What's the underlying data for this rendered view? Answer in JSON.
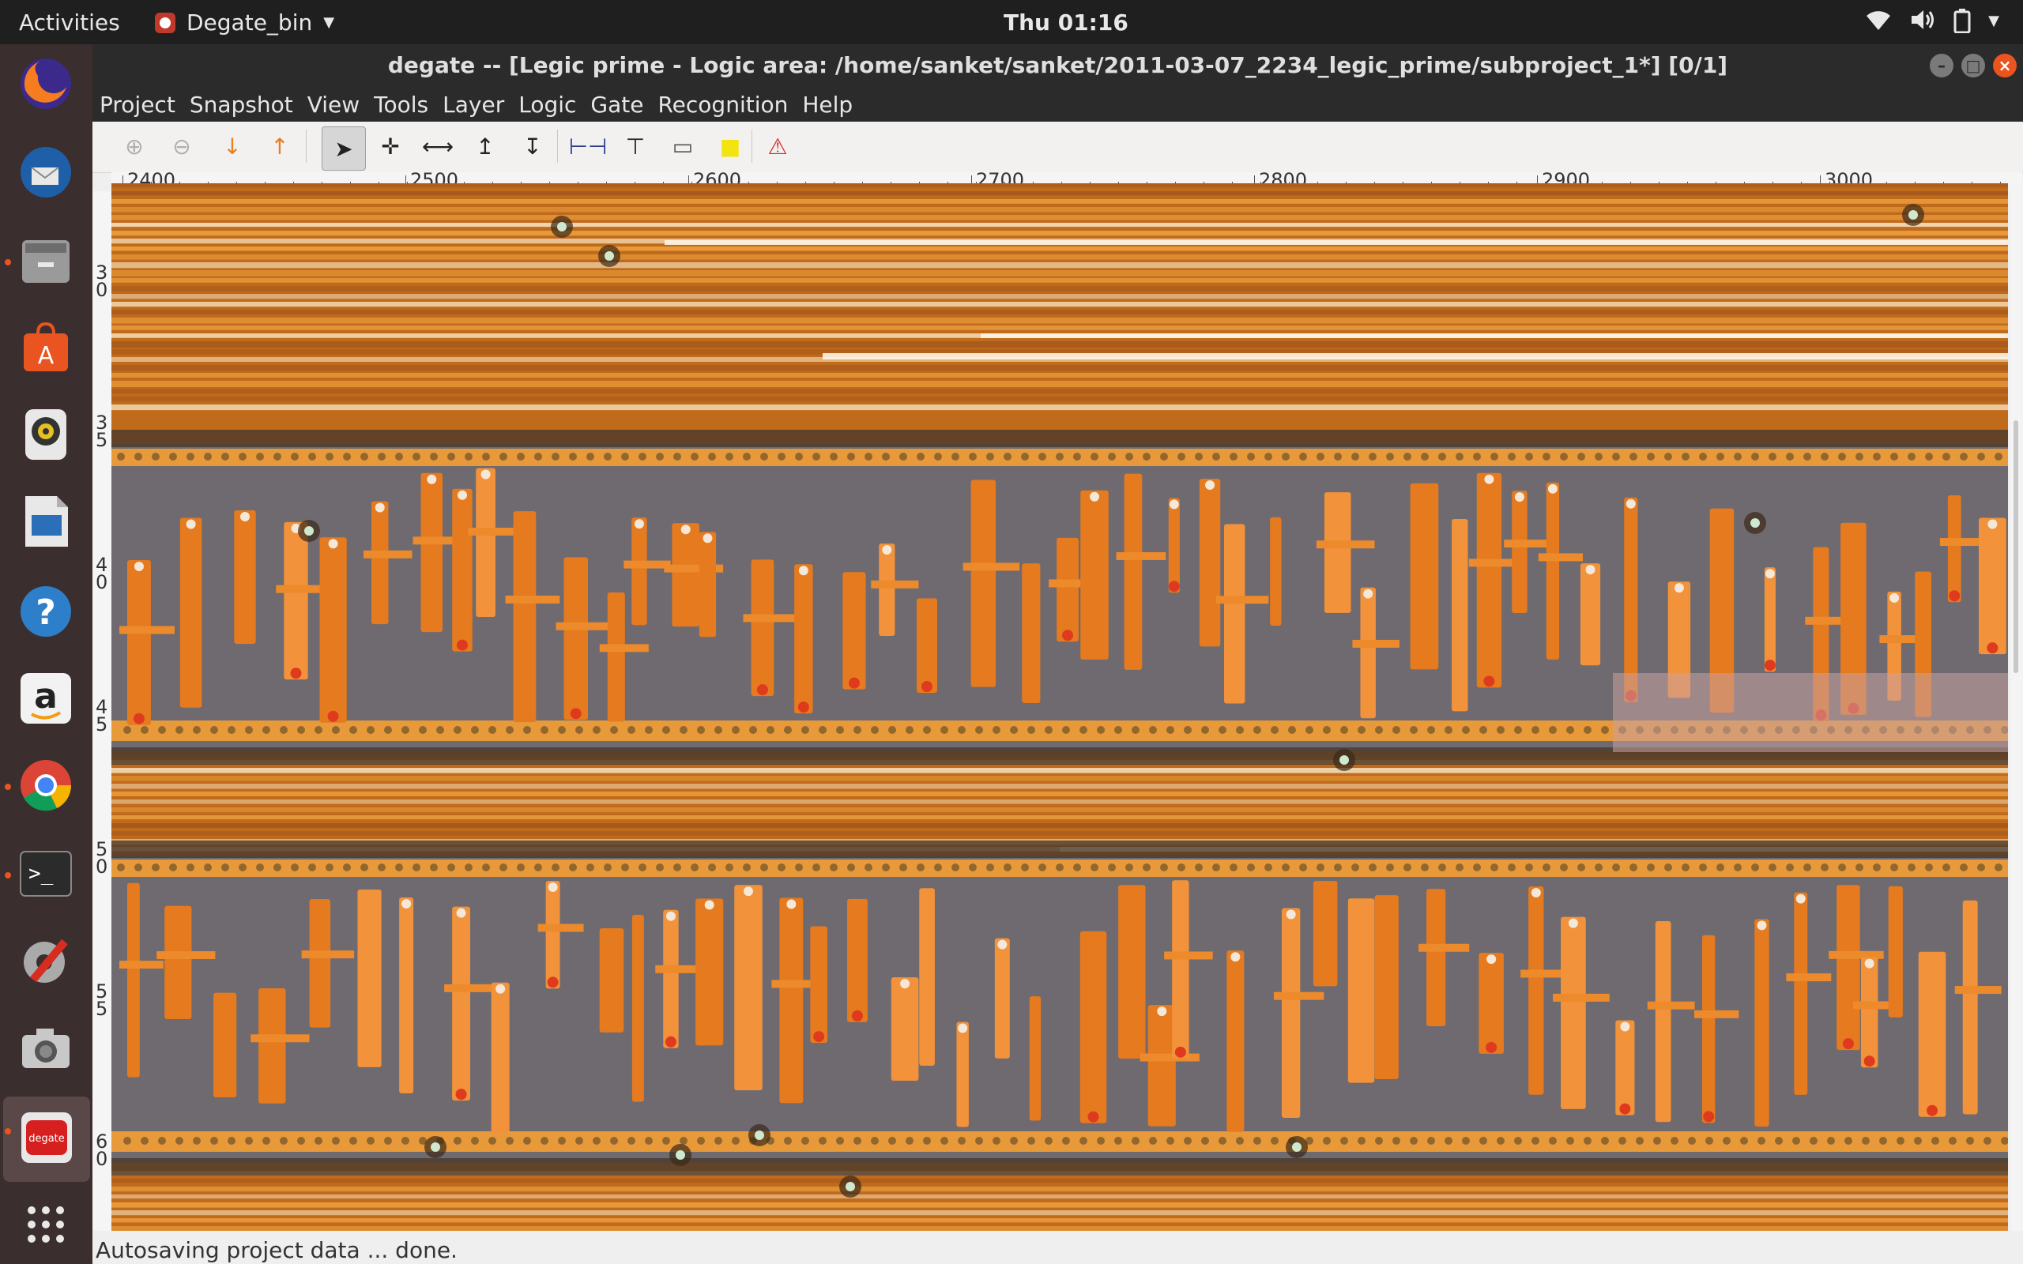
{
  "topbar": {
    "activities_label": "Activities",
    "app_name": "Degate_bin",
    "clock": "Thu 01:16"
  },
  "dock": {
    "items": [
      {
        "name": "firefox",
        "glyph": ""
      },
      {
        "name": "thunderbird",
        "glyph": ""
      },
      {
        "name": "files",
        "glyph": ""
      },
      {
        "name": "software-center",
        "glyph": "A"
      },
      {
        "name": "rhythmbox",
        "glyph": ""
      },
      {
        "name": "libreoffice-impress",
        "glyph": ""
      },
      {
        "name": "help",
        "glyph": "?"
      },
      {
        "name": "amazon",
        "glyph": "a"
      },
      {
        "name": "chrome",
        "glyph": ""
      },
      {
        "name": "terminal",
        "glyph": ">_"
      },
      {
        "name": "system-settings",
        "glyph": ""
      },
      {
        "name": "screenshot",
        "glyph": ""
      },
      {
        "name": "degate",
        "glyph": "degate"
      },
      {
        "name": "show-applications",
        "glyph": ""
      }
    ]
  },
  "window": {
    "title": "degate -- [Legic prime - Logic area: /home/sanket/sanket/2011-03-07_2234_legic_prime/subproject_1*] [0/1]",
    "minimize_glyph": "–",
    "maximize_glyph": "□",
    "close_glyph": "×"
  },
  "menubar": {
    "items": [
      "Project",
      "Snapshot",
      "View",
      "Tools",
      "Layer",
      "Logic",
      "Gate",
      "Recognition",
      "Help"
    ]
  },
  "toolbar": {
    "tools": [
      {
        "name": "zoom-in-tool",
        "glyph": "⊕",
        "icon": "zoom-in-icon",
        "color": "#b0b0b0"
      },
      {
        "name": "zoom-out-tool",
        "glyph": "⊖",
        "icon": "zoom-out-icon",
        "color": "#b0b0b0"
      },
      {
        "name": "layer-down-tool",
        "glyph": "↓",
        "icon": "arrow-down-icon",
        "color": "#e67e22"
      },
      {
        "name": "layer-up-tool",
        "glyph": "↑",
        "icon": "arrow-up-icon",
        "color": "#e67e22"
      },
      {
        "name": "select-tool",
        "glyph": "➤",
        "icon": "pointer-icon",
        "color": "#222222"
      },
      {
        "name": "move-tool",
        "glyph": "✛",
        "icon": "move-icon",
        "color": "#222222"
      },
      {
        "name": "wire-tool",
        "glyph": "⟷",
        "icon": "wire-icon",
        "color": "#222222"
      },
      {
        "name": "via-up-tool",
        "glyph": "↥",
        "icon": "via-up-icon",
        "color": "#222222"
      },
      {
        "name": "via-down-tool",
        "glyph": "↧",
        "icon": "via-down-icon",
        "color": "#222222"
      },
      {
        "name": "measure-tool",
        "glyph": "⊢⊣",
        "icon": "measure-icon",
        "color": "#2c3e90"
      },
      {
        "name": "emarker-tool",
        "glyph": "⊤",
        "icon": "emarker-icon",
        "color": "#222222"
      },
      {
        "name": "annotation-tool",
        "glyph": "▭",
        "icon": "annotation-icon",
        "color": "#555555"
      },
      {
        "name": "note-tool",
        "glyph": "■",
        "icon": "note-icon",
        "color": "#f1e40f"
      },
      {
        "name": "rule-check-tool",
        "glyph": "⚠",
        "icon": "warning-icon",
        "color": "#d32f2f"
      }
    ]
  },
  "ruler": {
    "h_labels": [
      "2400",
      "2500",
      "2600",
      "2700",
      "2800",
      "2900",
      "3000"
    ],
    "v_labels": [
      "3\n0",
      "3\n5",
      "4\n0",
      "4\n5",
      "5\n0",
      "5\n5",
      "6\n0"
    ]
  },
  "status": {
    "message": "Autosaving project data ... done."
  },
  "colors": {
    "die_base": "#c06a1c",
    "die_metal": "#e89a3a",
    "die_dark": "#4a3a2a",
    "die_gray": "#6e6a70",
    "die_bright": "#f3d8b0"
  }
}
